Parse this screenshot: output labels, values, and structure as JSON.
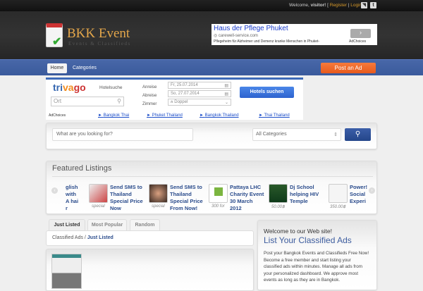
{
  "topbar": {
    "welcome": "Welcome,",
    "user": "visitor!",
    "register": "Register",
    "login": "Login"
  },
  "logo": {
    "title": "BKK Event",
    "subtitle": "Events & Classifieds"
  },
  "header_ad": {
    "title": "Haus der Pflege Phuket",
    "url": "carewell-service.com",
    "text": "Pflegeheim für Alzheimer und Demenz kranke Menschen in Phuket-",
    "adchoices": "AdChoices"
  },
  "nav": {
    "items": [
      "Home",
      "Categories"
    ],
    "post_ad": "Post an Ad"
  },
  "trivago_ad": {
    "brand": "trivago",
    "hotelsuche": "Hotelsuche",
    "ort_placeholder": "Ort",
    "anreise_label": "Anreise",
    "anreise": "Fr,  25.07.2014",
    "abreise_label": "Abreise",
    "abreise": "So, 27.07.2014",
    "zimmer_label": "Zimmer",
    "zimmer": "Doppel",
    "button": "Hotels suchen",
    "adchoices": "AdChoices",
    "links": [
      "Bangkok Thai",
      "Phuket Thailand",
      "Bangkok Thailand",
      "Thai Thailand"
    ]
  },
  "search": {
    "placeholder": "What are you looking for?",
    "category": "All Categories"
  },
  "featured": {
    "title": "Featured Listings",
    "items": [
      {
        "title": "glish with A hai r",
        "price": ""
      },
      {
        "title": "Send SMS to Thailand Special Price Now",
        "price": "special"
      },
      {
        "title": "Send SMS to Thailand Special Price From Now!",
        "price": "special"
      },
      {
        "title": "Pattaya LHC Charity Event 30 March 2012",
        "price": "300 for"
      },
      {
        "title": "Dj School helping HIV Temple",
        "price": "50.00฿"
      },
      {
        "title": "Power! Social Experi",
        "price": "350.00฿"
      }
    ]
  },
  "tabs": [
    "Just Listed",
    "Most Popular",
    "Random"
  ],
  "breadcrumb": {
    "root": "Classified Ads",
    "sep": "/",
    "current": "Just Listed"
  },
  "sidebar": {
    "welcome": "Welcome to our Web site!",
    "heading": "List Your Classified Ads",
    "body": "Post your Bangkok Events and Classifieds Free Now! Become a free member and start listing your classified ads within minutes. Manage all ads from your personalized dashboard. We approve most events as long as they are in Bangkok."
  }
}
